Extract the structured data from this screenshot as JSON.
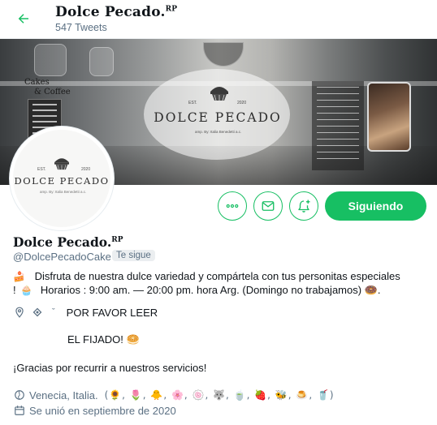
{
  "header": {
    "name": "Dolce Pecado.",
    "name_suffix": "RP",
    "tweet_count": "547 Tweets"
  },
  "banner": {
    "brand": "DOLCE PECADO",
    "est": "EST.",
    "year": "2020",
    "tagline": "amp. By: Italia Benedetti a.c.",
    "cafe_sign_line1": "Cakes",
    "cafe_sign_line2": "& Coffee"
  },
  "avatar": {
    "brand": "DOLCE PECADO",
    "est": "EST.",
    "year": "2020",
    "tagline": "amp. By: Italia Benedetti a.c."
  },
  "actions": {
    "more_label": "Más",
    "message_label": "Mensaje",
    "notify_label": "Notificaciones",
    "follow_label": "Siguiendo"
  },
  "profile": {
    "name": "Dolce Pecado.",
    "name_suffix": "RP",
    "handle": "@DolcePecadoCake",
    "follows_you": "Te sigue"
  },
  "bio": {
    "line1_emoji": "🍰",
    "line1": "Disfruta de nuestra dulce variedad y compártela con tus personitas especiales",
    "line2_prefix": "!",
    "line2_emoji": "🧁",
    "line2": "Horarios : 9:00 am. — 20:00 pm. hora Arg. (Domingo no trabajamos) 🍩.",
    "line3_suffix": "POR FAVOR LEER",
    "line4": "EL FIJADO! 🥯",
    "line5": "¡Gracias por recurrir a nuestros servicios!"
  },
  "meta": {
    "location": "Venecia, Italia.",
    "location_emojis": "(🌻, 🌷, 🐥, 🌸, 🍥, 🐺, 🍵, 🍓, 🐝, 🍮, 🥤)",
    "joined": "Se unió en septiembre de 2020"
  },
  "colors": {
    "accent": "#17bf63",
    "secondary_text": "#5b7083"
  },
  "icons": [
    "arrow-left-icon",
    "more-icon",
    "mail-icon",
    "bell-plus-icon",
    "location-icon",
    "calendar-icon"
  ]
}
